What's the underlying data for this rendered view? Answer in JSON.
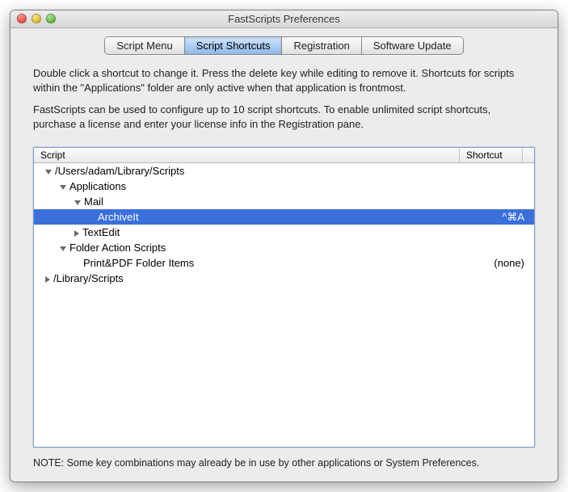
{
  "window": {
    "title": "FastScripts Preferences"
  },
  "tabs": {
    "items": [
      "Script Menu",
      "Script Shortcuts",
      "Registration",
      "Software Update"
    ],
    "active_index": 1
  },
  "description": {
    "p1": "Double click a shortcut to change it. Press the delete key while editing to remove it.  Shortcuts for scripts within the \"Applications\" folder are only active when that application is frontmost.",
    "p2": "FastScripts can be used to configure up to 10 script shortcuts. To enable unlimited script shortcuts,  purchase a license and enter your license info in the Registration pane."
  },
  "columns": {
    "script": "Script",
    "shortcut": "Shortcut"
  },
  "tree": [
    {
      "label": "/Users/adam/Library/Scripts",
      "indent": 0,
      "disclosure": "down",
      "shortcut": "",
      "selected": false
    },
    {
      "label": "Applications",
      "indent": 1,
      "disclosure": "down",
      "shortcut": "",
      "selected": false
    },
    {
      "label": "Mail",
      "indent": 2,
      "disclosure": "down",
      "shortcut": "",
      "selected": false
    },
    {
      "label": "ArchiveIt",
      "indent": 3,
      "disclosure": "",
      "shortcut": "^⌘A",
      "selected": true
    },
    {
      "label": "TextEdit",
      "indent": 2,
      "disclosure": "right",
      "shortcut": "",
      "selected": false
    },
    {
      "label": "Folder Action Scripts",
      "indent": 1,
      "disclosure": "down",
      "shortcut": "",
      "selected": false
    },
    {
      "label": "Print&PDF Folder Items",
      "indent": 2,
      "disclosure": "",
      "shortcut": "(none)",
      "selected": false
    },
    {
      "label": "/Library/Scripts",
      "indent": 0,
      "disclosure": "right",
      "shortcut": "",
      "selected": false
    }
  ],
  "note": "NOTE: Some key combinations may already be in use by other applications or System Preferences."
}
